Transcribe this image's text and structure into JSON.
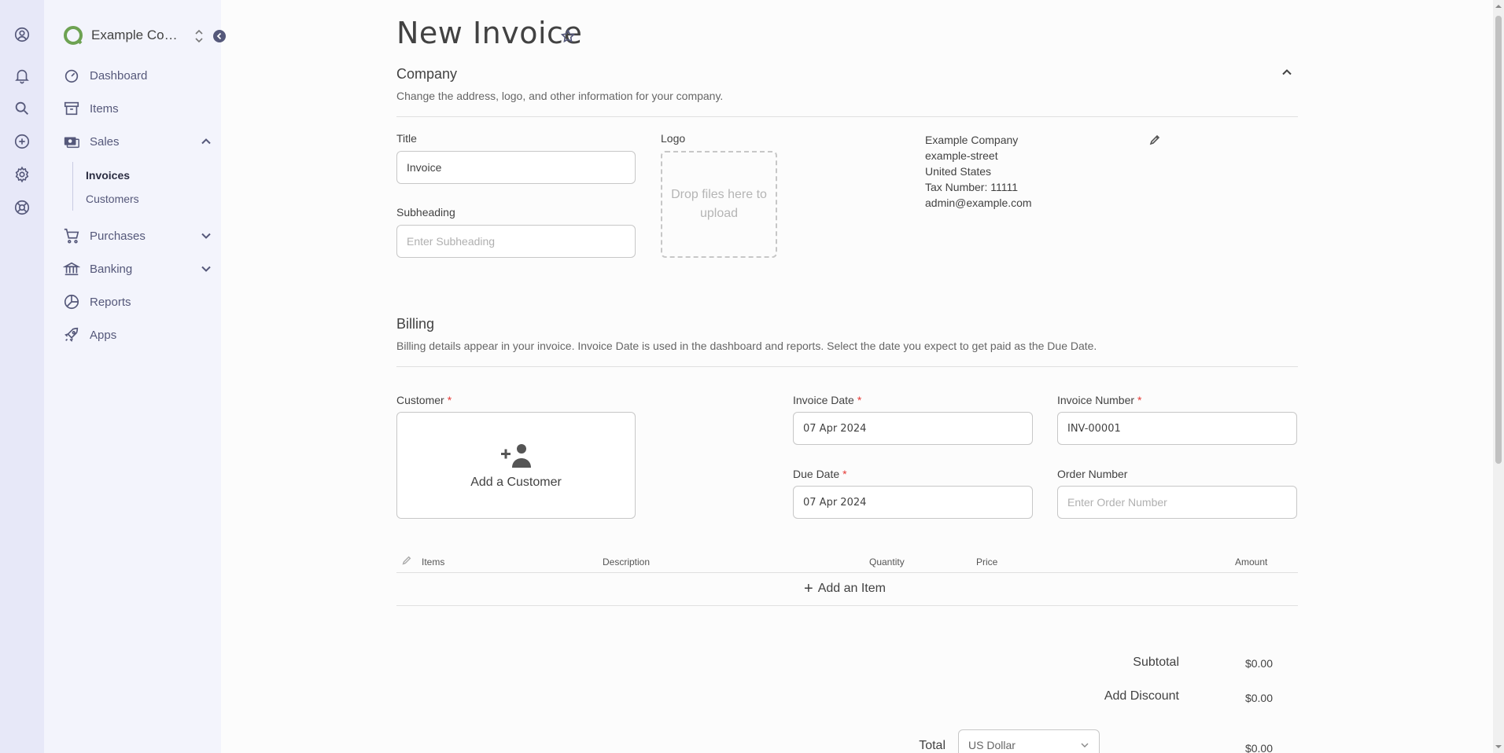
{
  "rail": {
    "icons": [
      "profile-icon",
      "notification-bell-icon",
      "search-icon",
      "add-new-icon",
      "settings-gear-icon",
      "help-lifebuoy-icon"
    ]
  },
  "brand": {
    "company_name": "Example Com...",
    "accent_color": "#6da252"
  },
  "sidebar": {
    "items": [
      {
        "label": "Dashboard",
        "icon": "speedometer-icon"
      },
      {
        "label": "Items",
        "icon": "archive-box-icon"
      },
      {
        "label": "Sales",
        "icon": "money-icon"
      },
      {
        "label": "Purchases",
        "icon": "shopping-cart-icon"
      },
      {
        "label": "Banking",
        "icon": "bank-icon"
      },
      {
        "label": "Reports",
        "icon": "pie-chart-icon"
      },
      {
        "label": "Apps",
        "icon": "rocket-icon"
      }
    ],
    "sales_sub": [
      {
        "label": "Invoices",
        "active": true
      },
      {
        "label": "Customers",
        "active": false
      }
    ]
  },
  "page": {
    "title": "New Invoice"
  },
  "company": {
    "heading": "Company",
    "description": "Change the address, logo, and other information for your company.",
    "title_label": "Title",
    "title_value": "Invoice",
    "subheading_label": "Subheading",
    "subheading_placeholder": "Enter Subheading",
    "logo_label": "Logo",
    "dropzone_text": "Drop files here to upload",
    "info": {
      "name": "Example Company",
      "street": "example-street",
      "country": "United States",
      "tax": "Tax Number: 11111",
      "email": "admin@example.com"
    }
  },
  "billing": {
    "heading": "Billing",
    "description": "Billing details appear in your invoice. Invoice Date is used in the dashboard and reports. Select the date you expect to get paid as the Due Date.",
    "customer_label": "Customer",
    "add_customer": "Add a Customer",
    "invoice_date_label": "Invoice Date",
    "invoice_date_value": "07 Apr 2024",
    "invoice_number_label": "Invoice Number",
    "invoice_number_value": "INV-00001",
    "due_date_label": "Due Date",
    "due_date_value": "07 Apr 2024",
    "order_number_label": "Order Number",
    "order_number_placeholder": "Enter Order Number",
    "required_mark": "*"
  },
  "items_table": {
    "columns": [
      "Items",
      "Description",
      "Quantity",
      "Price",
      "Amount"
    ],
    "add_item": "Add an Item"
  },
  "totals": {
    "subtotal_label": "Subtotal",
    "subtotal_value": "$0.00",
    "discount_label": "Add Discount",
    "discount_value": "$0.00",
    "total_label": "Total",
    "currency": "US Dollar",
    "total_value": "$0.00"
  }
}
